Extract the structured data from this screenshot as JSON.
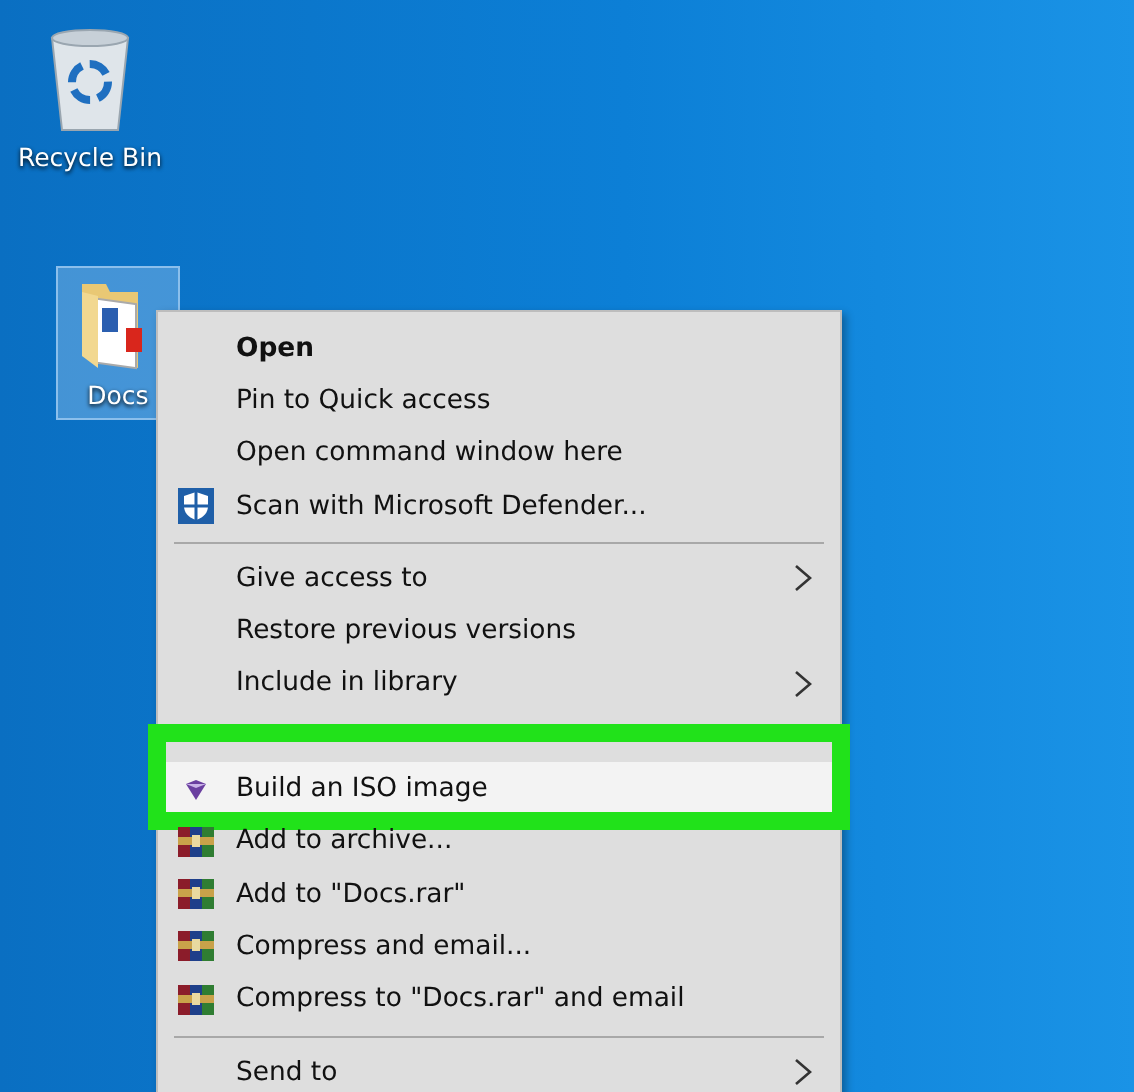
{
  "desktop_icons": [
    {
      "label": "Recycle Bin",
      "selected": false
    },
    {
      "label": "Docs",
      "selected": true
    }
  ],
  "context_menu": {
    "items": [
      {
        "kind": "plain",
        "label": "Open",
        "default": true
      },
      {
        "kind": "plain",
        "label": "Pin to Quick access"
      },
      {
        "kind": "plain",
        "label": "Open command window here"
      },
      {
        "kind": "defender",
        "label": "Scan with Microsoft Defender..."
      },
      {
        "kind": "separator"
      },
      {
        "kind": "plain",
        "label": "Give access to",
        "submenu": true
      },
      {
        "kind": "plain",
        "label": "Restore previous versions"
      },
      {
        "kind": "plain",
        "label": "Include in library",
        "submenu": true
      },
      {
        "kind": "iso",
        "label": "Build an ISO image",
        "highlighted": true
      },
      {
        "kind": "archive",
        "label": "Add to archive..."
      },
      {
        "kind": "archive",
        "label": "Add to \"Docs.rar\""
      },
      {
        "kind": "archive",
        "label": "Compress and email..."
      },
      {
        "kind": "archive",
        "label": "Compress to \"Docs.rar\" and email"
      },
      {
        "kind": "separator"
      },
      {
        "kind": "plain",
        "label": "Send to",
        "submenu": true
      }
    ]
  }
}
